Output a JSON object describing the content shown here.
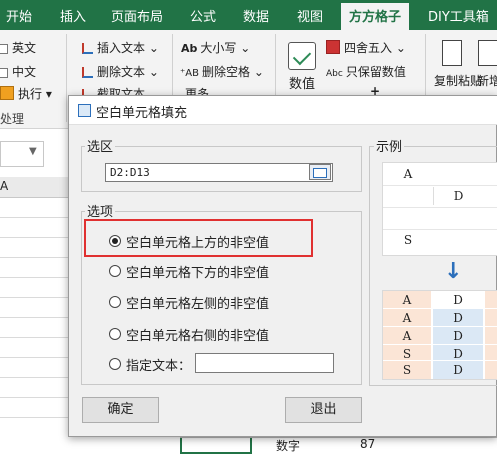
{
  "ribbon": {
    "tabs": [
      "开始",
      "插入",
      "页面布局",
      "公式",
      "数据",
      "视图",
      "方方格子",
      "DIY工具箱"
    ],
    "active_tab": "方方格子",
    "checks": [
      "英文",
      "中文"
    ],
    "execute": "执行",
    "execute_arrow": "▾",
    "group_label": "处理",
    "text_buttons": [
      "插入文本",
      "删除文本",
      "截取文本"
    ],
    "letter_buttons": [
      "大小写",
      "删除空格",
      "更多"
    ],
    "letter_icons": [
      "Ab",
      "AB"
    ],
    "num_buttons": [
      "四舍五入",
      "只保留数值"
    ],
    "num_icon": "Abc",
    "big_buttons": [
      "数值",
      "复制粘贴",
      "新增"
    ],
    "dropdown_arrow": "⌄",
    "plus": "+"
  },
  "sheet": {
    "col_letter": "A",
    "bottom_cells": [
      "数字",
      "87"
    ]
  },
  "dialog": {
    "title": "空白单元格填充",
    "range_group": "选区",
    "range_value": "D2:D13",
    "options_group": "选项",
    "options": [
      {
        "label": "空白单元格上方的非空值",
        "selected": true
      },
      {
        "label": "空白单元格下方的非空值",
        "selected": false
      },
      {
        "label": "空白单元格左侧的非空值",
        "selected": false
      },
      {
        "label": "空白单元格右侧的非空值",
        "selected": false
      },
      {
        "label": "指定文本：",
        "selected": false
      }
    ],
    "specified_text_value": "",
    "example_group": "示例",
    "example_before": [
      [
        "A",
        ""
      ],
      [
        "",
        "D"
      ],
      [
        "",
        ""
      ],
      [
        "S",
        ""
      ]
    ],
    "example_after": [
      [
        "A",
        "D"
      ],
      [
        "A",
        "D"
      ],
      [
        "S",
        "D"
      ],
      [
        "S",
        "D"
      ]
    ],
    "arrow": "↓",
    "ok_label": "确定",
    "exit_label": "退出",
    "highlight_color": "#e03030"
  }
}
